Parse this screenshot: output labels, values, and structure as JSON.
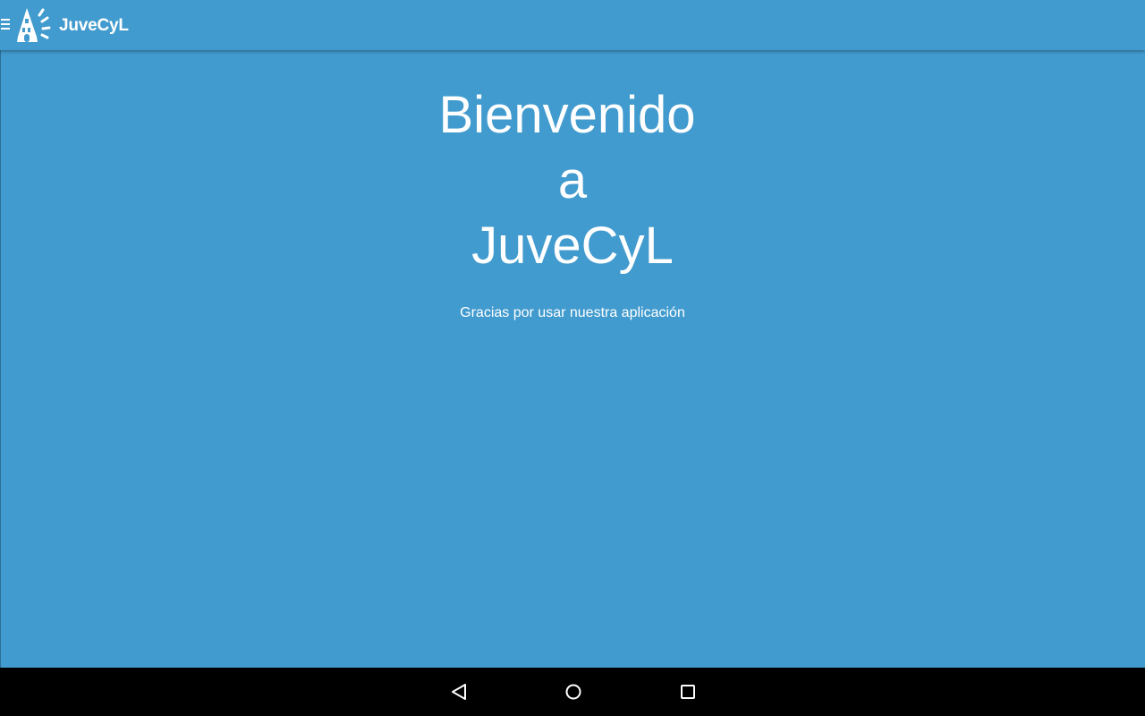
{
  "app_bar": {
    "title": "JuveCyL",
    "menu_icon": "menu-icon",
    "logo_icon": "juvecyl-logo-icon",
    "background_color": "#429bce"
  },
  "main": {
    "welcome_lines": [
      "Bienvenido",
      "a",
      "JuveCyL"
    ],
    "subtitle": "Gracias por usar nuestra aplicación",
    "background_color": "#429bce",
    "text_color": "#ffffff"
  },
  "nav_bar": {
    "buttons": [
      {
        "icon": "back-triangle-icon"
      },
      {
        "icon": "home-circle-icon"
      },
      {
        "icon": "recents-square-icon"
      }
    ],
    "background_color": "#000000"
  }
}
